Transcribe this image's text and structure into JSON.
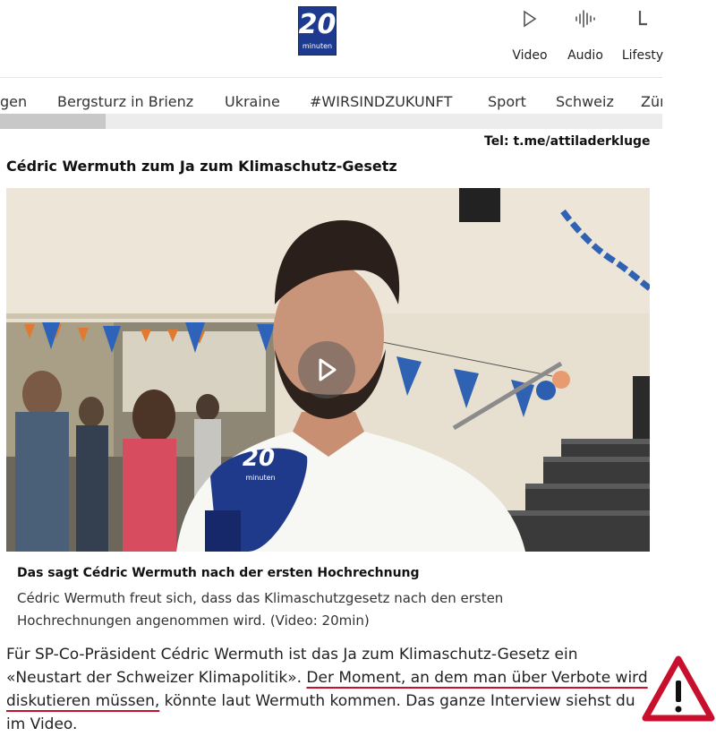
{
  "header": {
    "logo_number": "20",
    "logo_word": "minuten",
    "nav": [
      {
        "label": "Video",
        "icon": "play-icon"
      },
      {
        "label": "Audio",
        "icon": "audio-wave-icon"
      },
      {
        "label": "Lifesty",
        "icon": "lifestyle-icon"
      }
    ]
  },
  "tabs": [
    "gen",
    "Bergsturz in Brienz",
    "Ukraine",
    "#WIRSINDZUKUNFT",
    "Sport",
    "Schweiz",
    "Zür"
  ],
  "telegram": "Tel: t.me/attiladerkluge",
  "headline": "Cédric Wermuth zum Ja zum Klimaschutz-Gesetz",
  "video": {
    "mic_number": "20",
    "mic_word": "minuten",
    "caption_title": "Das sagt Cédric Wermuth nach der ersten Hochrechnung",
    "caption_text": "Cédric Wermuth freut sich, dass das Klimaschutzgesetz nach den ersten Hochrechnungen angenommen wird. (Video: 20min)"
  },
  "article": {
    "part1": "Für SP-Co-Präsident Cédric Wermuth ist das Ja zum Klimaschutz-Gesetz ein «Neustart der Schweizer Klimapolitik». ",
    "highlight": "Der Moment, an dem man über Verbote wird diskutieren müssen,",
    "part2": " könnte laut Wermuth kommen. Das ganze Interview siehst du im Video."
  },
  "colors": {
    "logo_blue": "#1d3a8f",
    "underline_red": "#c8102e",
    "warning_red": "#c8102e"
  }
}
